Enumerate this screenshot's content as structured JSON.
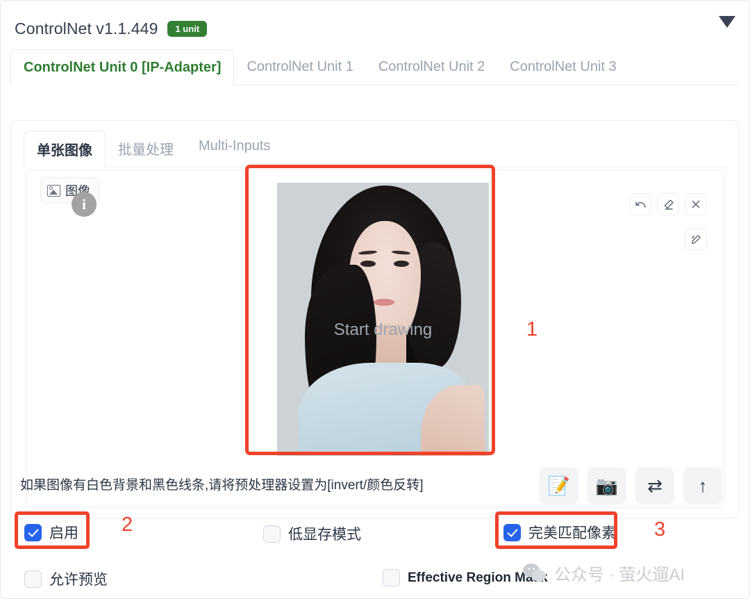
{
  "header": {
    "title": "ControlNet v1.1.449",
    "badge": "1 unit",
    "collapse_icon": "caret-down-icon"
  },
  "unit_tabs": [
    {
      "label": "ControlNet Unit 0 [IP-Adapter]",
      "active": true
    },
    {
      "label": "ControlNet Unit 1",
      "active": false
    },
    {
      "label": "ControlNet Unit 2",
      "active": false
    },
    {
      "label": "ControlNet Unit 3",
      "active": false
    }
  ],
  "source_tabs": [
    {
      "label": "单张图像",
      "active": true
    },
    {
      "label": "批量处理",
      "active": false
    },
    {
      "label": "Multi-Inputs",
      "active": false
    }
  ],
  "dropzone": {
    "image_chip_label": "图像",
    "cursor_badge": "i",
    "canvas_overlay_text": "Start drawing",
    "tools": [
      {
        "name": "undo-icon",
        "glyph": "↺"
      },
      {
        "name": "eraser-icon",
        "glyph": "⌫"
      },
      {
        "name": "close-icon",
        "glyph": "✕"
      },
      {
        "name": "pen-icon",
        "glyph": "✎"
      }
    ]
  },
  "hint": {
    "text": "如果图像有白色背景和黑色线条,请将预处理器设置为[invert/颜色反转]"
  },
  "action_buttons": [
    {
      "name": "open-new-canvas-button",
      "glyph": "📝"
    },
    {
      "name": "webcam-button",
      "glyph": "📷"
    },
    {
      "name": "swap-direction-button",
      "glyph": "⇄"
    },
    {
      "name": "send-dimensions-button",
      "glyph": "↑"
    }
  ],
  "checkboxes": {
    "enable": {
      "label": "启用",
      "checked": true
    },
    "low_vram": {
      "label": "低显存模式",
      "checked": false
    },
    "pixel_perfect": {
      "label": "完美匹配像素",
      "checked": true
    },
    "allow_preview": {
      "label": "允许预览",
      "checked": false
    },
    "effective_region_mask": {
      "label": "Effective Region Mask",
      "checked": false
    }
  },
  "annotations": {
    "num1": "1",
    "num2": "2",
    "num3": "3",
    "color": "#f0422a"
  },
  "watermark": {
    "text": "公众号 · 萤火遛AI",
    "logo": "wechat-logo"
  },
  "colors": {
    "accent_green": "#2f7d32",
    "badge_green": "#338033",
    "checkbox_blue": "#2563eb",
    "annotation_red": "#f0422a",
    "muted_text": "#9aa3b0"
  }
}
